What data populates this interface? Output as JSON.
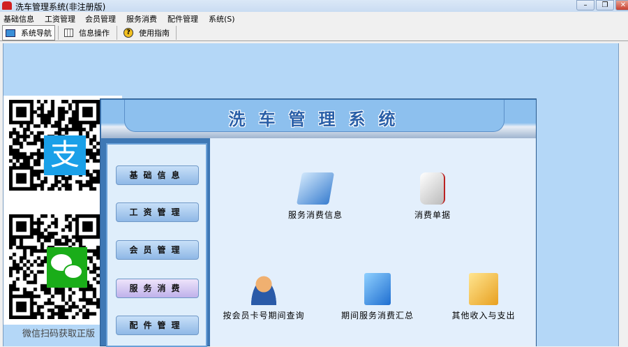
{
  "window": {
    "title": "洗车管理系统(非注册版)",
    "controls": [
      "minimize",
      "restore",
      "close"
    ]
  },
  "menu": [
    "基础信息",
    "工资管理",
    "会员管理",
    "服务消费",
    "配件管理",
    "系统(S)"
  ],
  "toolbar": [
    {
      "label": "系统导航",
      "icon": "monitor-icon"
    },
    {
      "label": "信息操作",
      "icon": "grid-icon"
    },
    {
      "label": "使用指南",
      "icon": "help-icon"
    }
  ],
  "qr": {
    "caption": "微信扫码获取正版",
    "alipay_color": "#1aa0e8",
    "wechat_color": "#1aad19"
  },
  "app": {
    "title": "洗车管理系统",
    "nav": [
      "基础信息",
      "工资管理",
      "会员管理",
      "服务消费",
      "配件管理"
    ],
    "selected_nav": "服务消费",
    "items": [
      "服务消费信息",
      "消费单据",
      "按会员卡号期间查询",
      "期间服务消费汇总",
      "其他收入与支出"
    ]
  }
}
